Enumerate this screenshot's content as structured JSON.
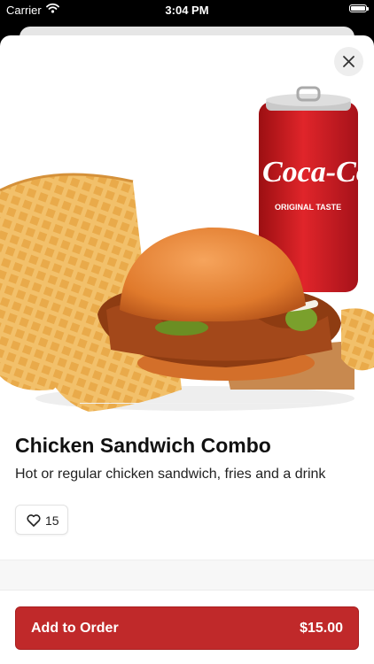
{
  "status_bar": {
    "carrier": "Carrier",
    "time": "3:04 PM"
  },
  "item": {
    "title": "Chicken Sandwich Combo",
    "description": "Hot or regular chicken sandwich, fries and a drink",
    "likes": "15",
    "image_subject": "chicken sandwich with waffle fries and a soda can",
    "can_text": "Coca-Cola",
    "can_subtext": "ORIGINAL TASTE"
  },
  "footer": {
    "add_label": "Add to Order",
    "price": "$15.00"
  },
  "icons": {
    "close": "close-icon",
    "heart": "heart-icon",
    "wifi": "wifi-icon",
    "battery": "battery-icon"
  },
  "colors": {
    "accent": "#c0292a"
  }
}
